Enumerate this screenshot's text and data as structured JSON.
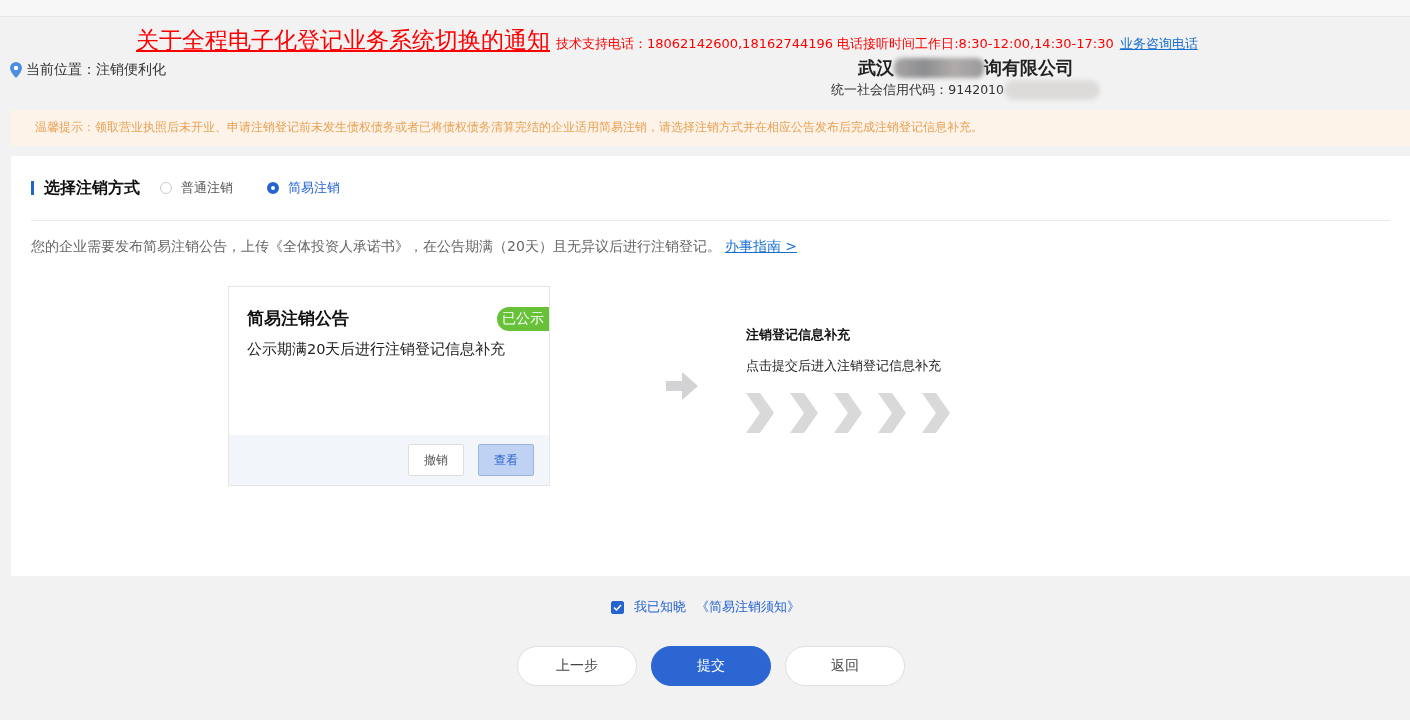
{
  "notice": {
    "title": "关于全程电子化登记业务系统切换的通知",
    "support": "技术支持电话：18062142600,18162744196 电话接听时间工作日:8:30-12:00,14:30-17:30",
    "consult_link": "业务咨询电话"
  },
  "location": {
    "label": "当前位置：注销便利化"
  },
  "company": {
    "name_start": "武汉",
    "name_end": "询有限公司",
    "credit_code": "统一社会信用代码：9142010"
  },
  "tip": "温馨提示：领取营业执照后未开业、申请注销登记前未发生债权债务或者已将债权债务清算完结的企业适用简易注销，请选择注销方式并在相应公告发布后完成注销登记信息补充。",
  "method": {
    "title": "选择注销方式",
    "options": [
      {
        "label": "普通注销",
        "selected": false
      },
      {
        "label": "简易注销",
        "selected": true
      }
    ]
  },
  "description": "您的企业需要发布简易注销公告，上传《全体投资人承诺书》，在公告期满（20天）且无异议后进行注销登记。",
  "guide_link": "办事指南 >",
  "announcement_card": {
    "title": "简易注销公告",
    "badge": "已公示",
    "text": "公示期满20天后进行注销登记信息补充",
    "buttons": [
      {
        "label": "撤销",
        "kind": "plain"
      },
      {
        "label": "查看",
        "kind": "primary"
      }
    ]
  },
  "next_step": {
    "title": "注销登记信息补充",
    "text": "点击提交后进入注销登记信息补充"
  },
  "agreement": {
    "checked": true,
    "label": "我已知晓",
    "link": "《简易注销须知》"
  },
  "actions": [
    {
      "label": "上一步",
      "kind": "plain"
    },
    {
      "label": "提交",
      "kind": "primary"
    },
    {
      "label": "返回",
      "kind": "plain"
    }
  ]
}
